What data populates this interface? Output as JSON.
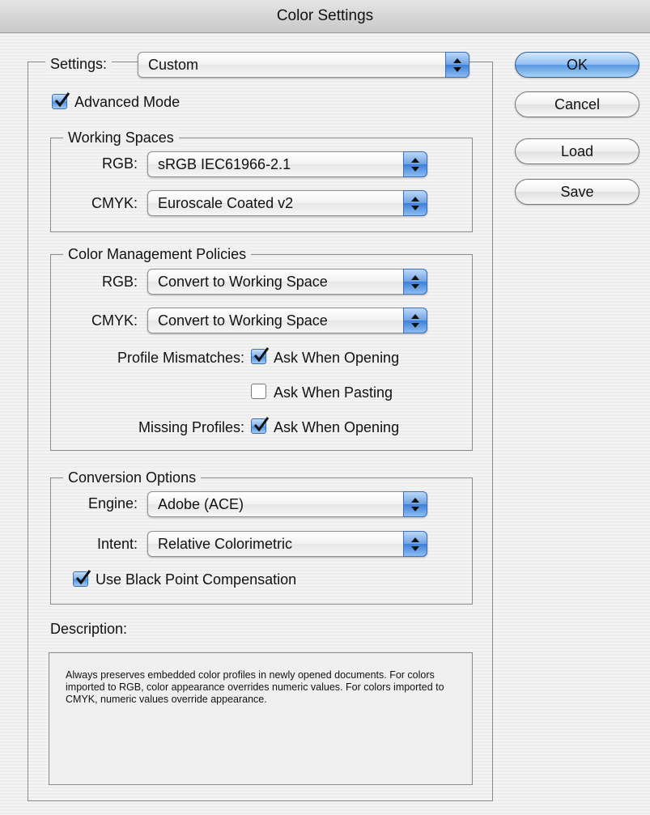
{
  "window": {
    "title": "Color Settings"
  },
  "settings": {
    "label": "Settings:",
    "value": "Custom",
    "advanced_mode_label": "Advanced Mode",
    "advanced_mode_checked": true
  },
  "working_spaces": {
    "title": "Working Spaces",
    "rgb_label": "RGB:",
    "rgb_value": "sRGB IEC61966-2.1",
    "cmyk_label": "CMYK:",
    "cmyk_value": "Euroscale Coated v2"
  },
  "policies": {
    "title": "Color Management Policies",
    "rgb_label": "RGB:",
    "rgb_value": "Convert to Working Space",
    "cmyk_label": "CMYK:",
    "cmyk_value": "Convert to Working Space",
    "mismatch_label": "Profile Mismatches:",
    "ask_opening_label": "Ask When Opening",
    "ask_opening_checked": true,
    "ask_pasting_label": "Ask When Pasting",
    "ask_pasting_checked": false,
    "missing_label": "Missing Profiles:",
    "missing_ask_opening_label": "Ask When Opening",
    "missing_ask_opening_checked": true
  },
  "conversion": {
    "title": "Conversion Options",
    "engine_label": "Engine:",
    "engine_value": "Adobe (ACE)",
    "intent_label": "Intent:",
    "intent_value": "Relative Colorimetric",
    "bpc_label": "Use Black Point Compensation",
    "bpc_checked": true
  },
  "description": {
    "title": "Description:",
    "text": "Always preserves embedded color profiles in newly opened documents. For colors imported to RGB, color appearance overrides numeric values. For colors imported to CMYK, numeric values override appearance."
  },
  "buttons": {
    "ok": "OK",
    "cancel": "Cancel",
    "load": "Load",
    "save": "Save"
  },
  "colors": {
    "accent": "#5797e0",
    "check_fill": "#4b8ddc"
  }
}
